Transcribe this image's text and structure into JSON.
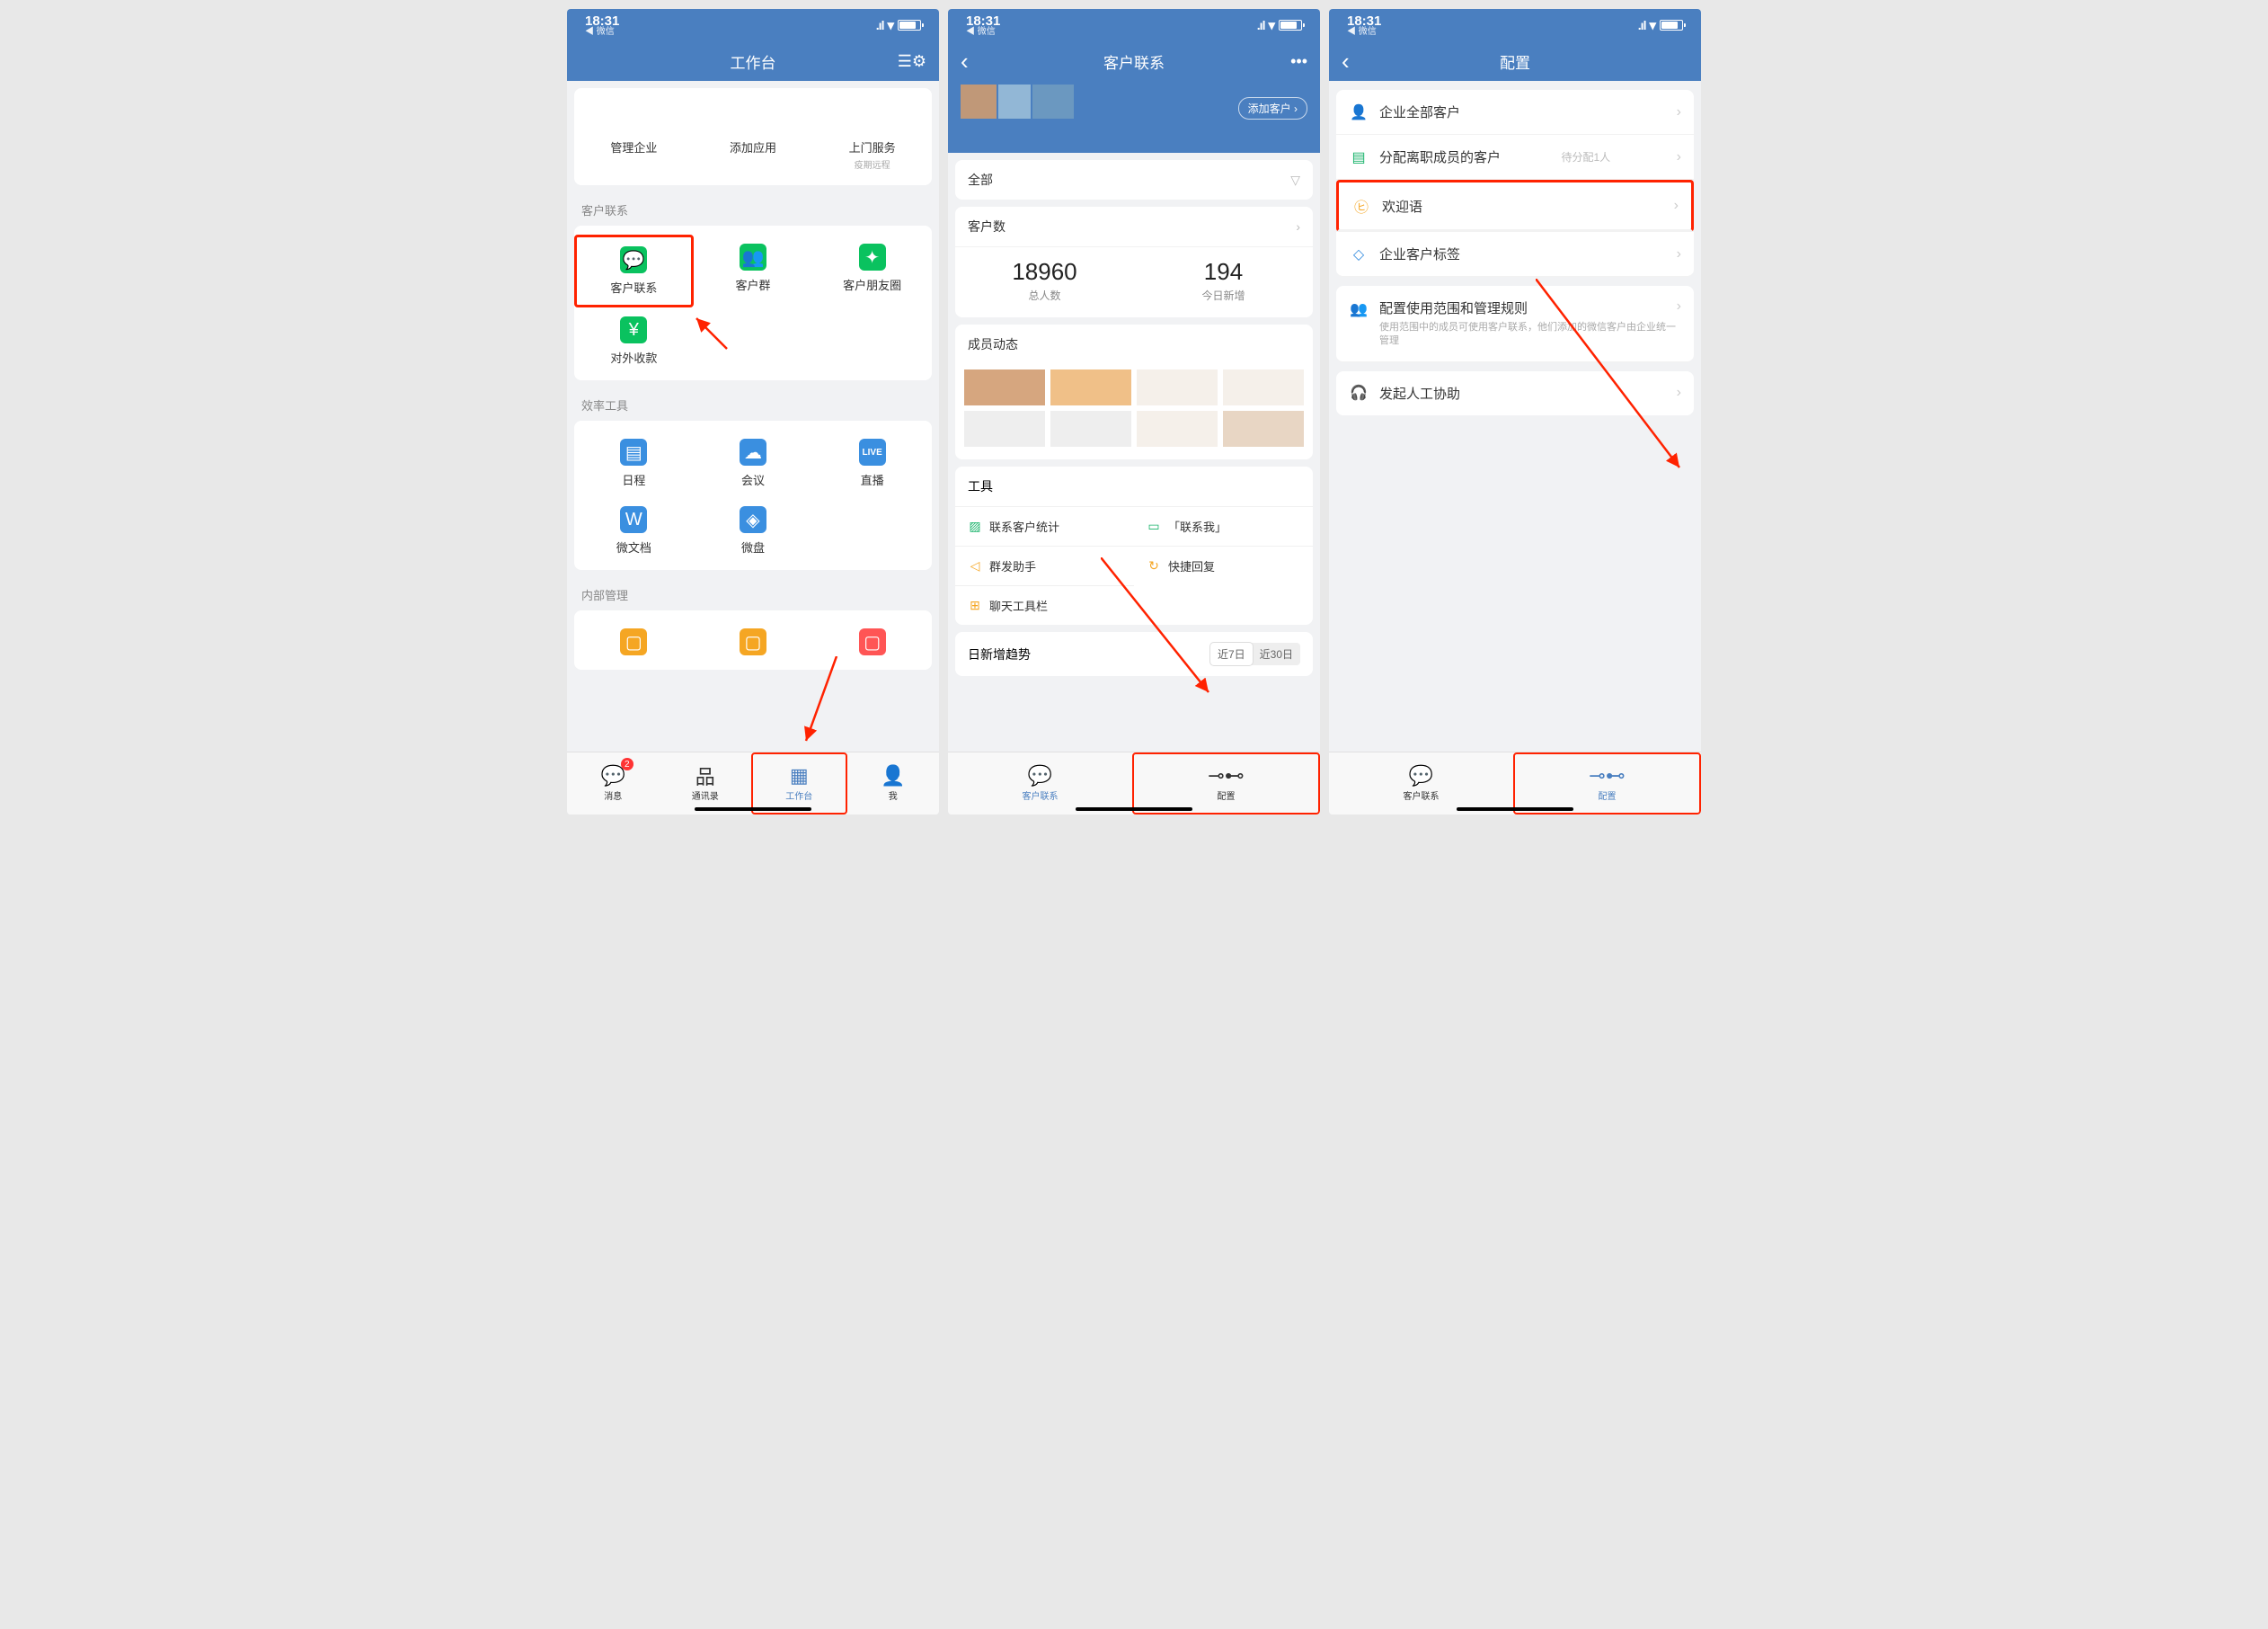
{
  "status": {
    "time": "18:31",
    "back": "◀ 微信",
    "signal": "▪▫ ▴",
    "wifi": "📶"
  },
  "s1": {
    "title": "工作台",
    "top": [
      {
        "label": "管理企业",
        "sub": ""
      },
      {
        "label": "添加应用",
        "sub": ""
      },
      {
        "label": "上门服务",
        "sub": "疫期远程"
      }
    ],
    "sec1": "客户联系",
    "g1": [
      "客户联系",
      "客户群",
      "客户朋友圈",
      "对外收款"
    ],
    "sec2": "效率工具",
    "g2": [
      "日程",
      "会议",
      "直播",
      "微文档",
      "微盘"
    ],
    "sec3": "内部管理",
    "tabs": [
      "消息",
      "通讯录",
      "工作台",
      "我"
    ],
    "badge": "2"
  },
  "s2": {
    "title": "客户联系",
    "addcust": "添加客户 ›",
    "all": "全部",
    "khs": "客户数",
    "total": "18960",
    "total_l": "总人数",
    "today": "194",
    "today_l": "今日新增",
    "members": "成员动态",
    "toolsh": "工具",
    "tools": [
      [
        "联系客户统计",
        "「联系我」"
      ],
      [
        "群发助手",
        "快捷回复"
      ],
      [
        "聊天工具栏",
        ""
      ]
    ],
    "trend": "日新增趋势",
    "seg": [
      "近7日",
      "近30日"
    ],
    "tabs": [
      "客户联系",
      "配置"
    ]
  },
  "s3": {
    "title": "配置",
    "items": [
      {
        "label": "企业全部客户"
      },
      {
        "label": "分配离职成员的客户",
        "hint": "待分配1人"
      },
      {
        "label": "欢迎语",
        "hl": true
      },
      {
        "label": "企业客户标签"
      }
    ],
    "cfg": {
      "label": "配置使用范围和管理规则",
      "desc": "使用范围中的成员可使用客户联系，他们添加的微信客户由企业统一管理"
    },
    "assist": "发起人工协助",
    "tabs": [
      "客户联系",
      "配置"
    ]
  }
}
